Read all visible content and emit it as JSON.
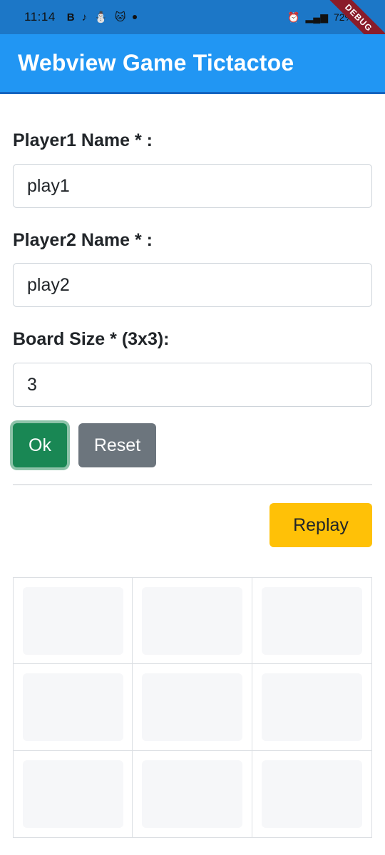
{
  "status_bar": {
    "time": "11:14",
    "icons_left": [
      "B",
      "♪",
      "⛄",
      "🐱"
    ],
    "battery": "72%"
  },
  "debug_banner": "DEBUG",
  "app_bar": {
    "title": "Webview Game Tictactoe",
    "color": "#2196f3"
  },
  "form": {
    "player1_label": "Player1 Name * :",
    "player1_value": "play1",
    "player2_label": "Player2 Name * :",
    "player2_value": "play2",
    "board_size_label": "Board Size * (3x3):",
    "board_size_value": "3"
  },
  "buttons": {
    "ok_label": "Ok",
    "reset_label": "Reset",
    "replay_label": "Replay"
  },
  "board": {
    "size": 3,
    "cells": [
      "",
      "",
      "",
      "",
      "",
      "",
      "",
      "",
      ""
    ]
  }
}
